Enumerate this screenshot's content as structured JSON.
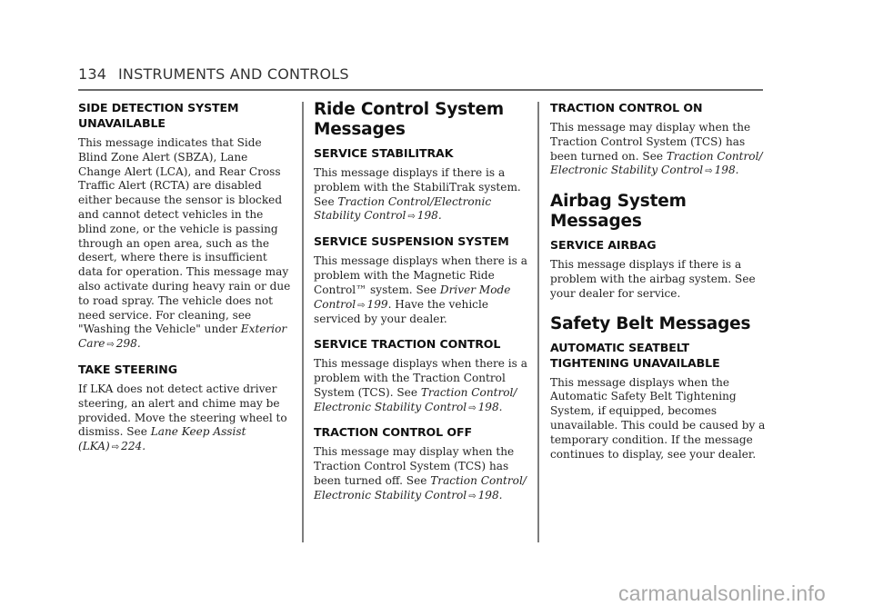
{
  "header": {
    "page_number": "134",
    "section_title": "INSTRUMENTS AND CONTROLS"
  },
  "columns": {
    "col1": {
      "side_detection": {
        "title_line1": "SIDE DETECTION SYSTEM",
        "title_line2": "UNAVAILABLE",
        "body": "This message indicates that Side Blind Zone Alert (SBZA), Lane Change Alert (LCA), and Rear Cross Traffic Alert (RCTA) are disabled either because the sensor is blocked and cannot detect vehicles in the blind zone, or the vehicle is passing through an open area, such as the desert, where there is insufficient data for operation. This message may also activate during heavy rain or due to road spray. The vehicle does not need service. For cleaning, see \"Washing the Vehicle\" under ",
        "ref_text": "Exterior Care",
        "ref_page": "298",
        "end": "."
      },
      "take_steering": {
        "title": "TAKE STEERING",
        "body": "If LKA does not detect active driver steering, an alert and chime may be provided. Move the steering wheel to dismiss. See ",
        "ref_text": "Lane Keep Assist (LKA)",
        "ref_page": "224",
        "end": "."
      }
    },
    "col2": {
      "section_title": "Ride Control System Messages",
      "service_stabilitrak": {
        "title": "SERVICE STABILITRAK",
        "body": "This message displays if there is a problem with the StabiliTrak system. See ",
        "ref_text": "Traction Control/Electronic Stability Control",
        "ref_page": "198",
        "end": "."
      },
      "service_suspension": {
        "title": "SERVICE SUSPENSION SYSTEM",
        "body": "This message displays when there is a problem with the Magnetic Ride Control™ system. See ",
        "ref_text": "Driver Mode Control",
        "ref_page": "199",
        "end": ". Have the vehicle serviced by your dealer."
      },
      "service_traction": {
        "title": "SERVICE TRACTION CONTROL",
        "body": "This message displays when there is a problem with the Traction Control System (TCS). See ",
        "ref_text": "Traction Control/ Electronic Stability Control",
        "ref_page": "198",
        "end": "."
      },
      "traction_off": {
        "title": "TRACTION CONTROL OFF",
        "body": "This message may display when the Traction Control System (TCS) has been turned off. See ",
        "ref_text": "Traction Control/ Electronic Stability Control",
        "ref_page": "198",
        "end": "."
      }
    },
    "col3": {
      "traction_on": {
        "title": "TRACTION CONTROL ON",
        "body": "This message may display when the Traction Control System (TCS) has been turned on. See ",
        "ref_text": "Traction Control/ Electronic Stability Control",
        "ref_page": "198",
        "end": "."
      },
      "airbag_section_title": "Airbag System Messages",
      "service_airbag": {
        "title": "SERVICE AIRBAG",
        "body": "This message displays if there is a problem with the airbag system. See your dealer for service."
      },
      "safety_belt_section_title": "Safety Belt Messages",
      "seatbelt_tightening": {
        "title_line1": "AUTOMATIC SEATBELT",
        "title_line2": "TIGHTENING UNAVAILABLE",
        "body": "This message displays when the Automatic Safety Belt Tightening System, if equipped, becomes unavailable. This could be caused by a temporary condition. If the message continues to display, see your dealer."
      }
    }
  },
  "icons": {
    "page_ref_arrow": "⇨"
  },
  "watermark": "carmanualsonline.info"
}
